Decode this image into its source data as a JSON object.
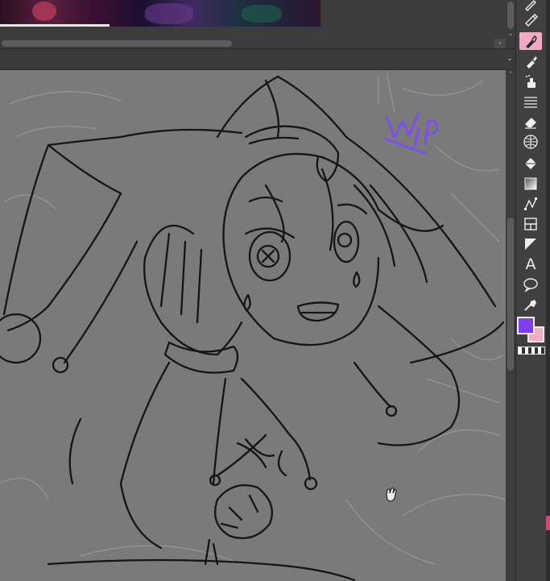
{
  "reference_panel": {
    "image_description_icon": "reference-image-thumbnail"
  },
  "canvas": {
    "background": "#7a7a7a",
    "annotation_text": "WIP",
    "annotation_color": "#7d4ff0"
  },
  "toolbar": {
    "tools": [
      {
        "name": "pen-tool-icon",
        "active": false
      },
      {
        "name": "pencil-tool-icon",
        "active": false
      },
      {
        "name": "brush-tool-icon",
        "active": true
      },
      {
        "name": "airbrush-tool-icon",
        "active": false
      },
      {
        "name": "decoration-tool-icon",
        "active": false
      },
      {
        "name": "line-hatch-icon",
        "active": false
      },
      {
        "name": "eraser-tool-icon",
        "active": false
      },
      {
        "name": "blend-tool-icon",
        "active": false
      },
      {
        "name": "fill-tool-icon",
        "active": false
      },
      {
        "name": "gradient-tool-icon",
        "active": false
      },
      {
        "name": "figure-tool-icon",
        "active": false
      },
      {
        "name": "frame-border-icon",
        "active": false
      },
      {
        "name": "ruler-tool-icon",
        "active": false
      },
      {
        "name": "text-tool-icon",
        "active": false
      },
      {
        "name": "balloon-tool-icon",
        "active": false
      },
      {
        "name": "correct-line-icon",
        "active": false
      }
    ],
    "text_tool_label": "A",
    "main_color": "#7f3cf0",
    "sub_color": "#f6a8c4"
  }
}
